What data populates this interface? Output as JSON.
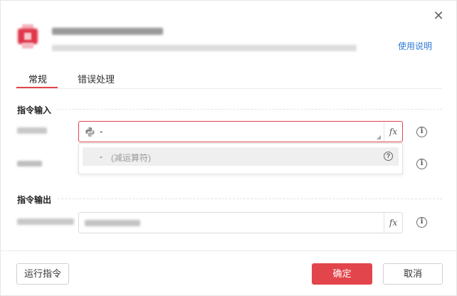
{
  "dialog": {
    "help_link": "使用说明",
    "close_icon": "close-icon"
  },
  "tabs": [
    {
      "label": "常规",
      "active": true
    },
    {
      "label": "错误处理",
      "active": false
    }
  ],
  "sections": {
    "input_title": "指令输入",
    "output_title": "指令输出"
  },
  "input_field": {
    "value": "-",
    "icon": "python-icon",
    "fx_label": "fx"
  },
  "dropdown": {
    "items": [
      {
        "operator": "-",
        "description": "(减运算符)",
        "icon": "help-icon"
      }
    ]
  },
  "footer": {
    "run_label": "运行指令",
    "ok_label": "确定",
    "cancel_label": "取消"
  },
  "colors": {
    "accent": "#e2454b",
    "link": "#2f7bd6"
  }
}
